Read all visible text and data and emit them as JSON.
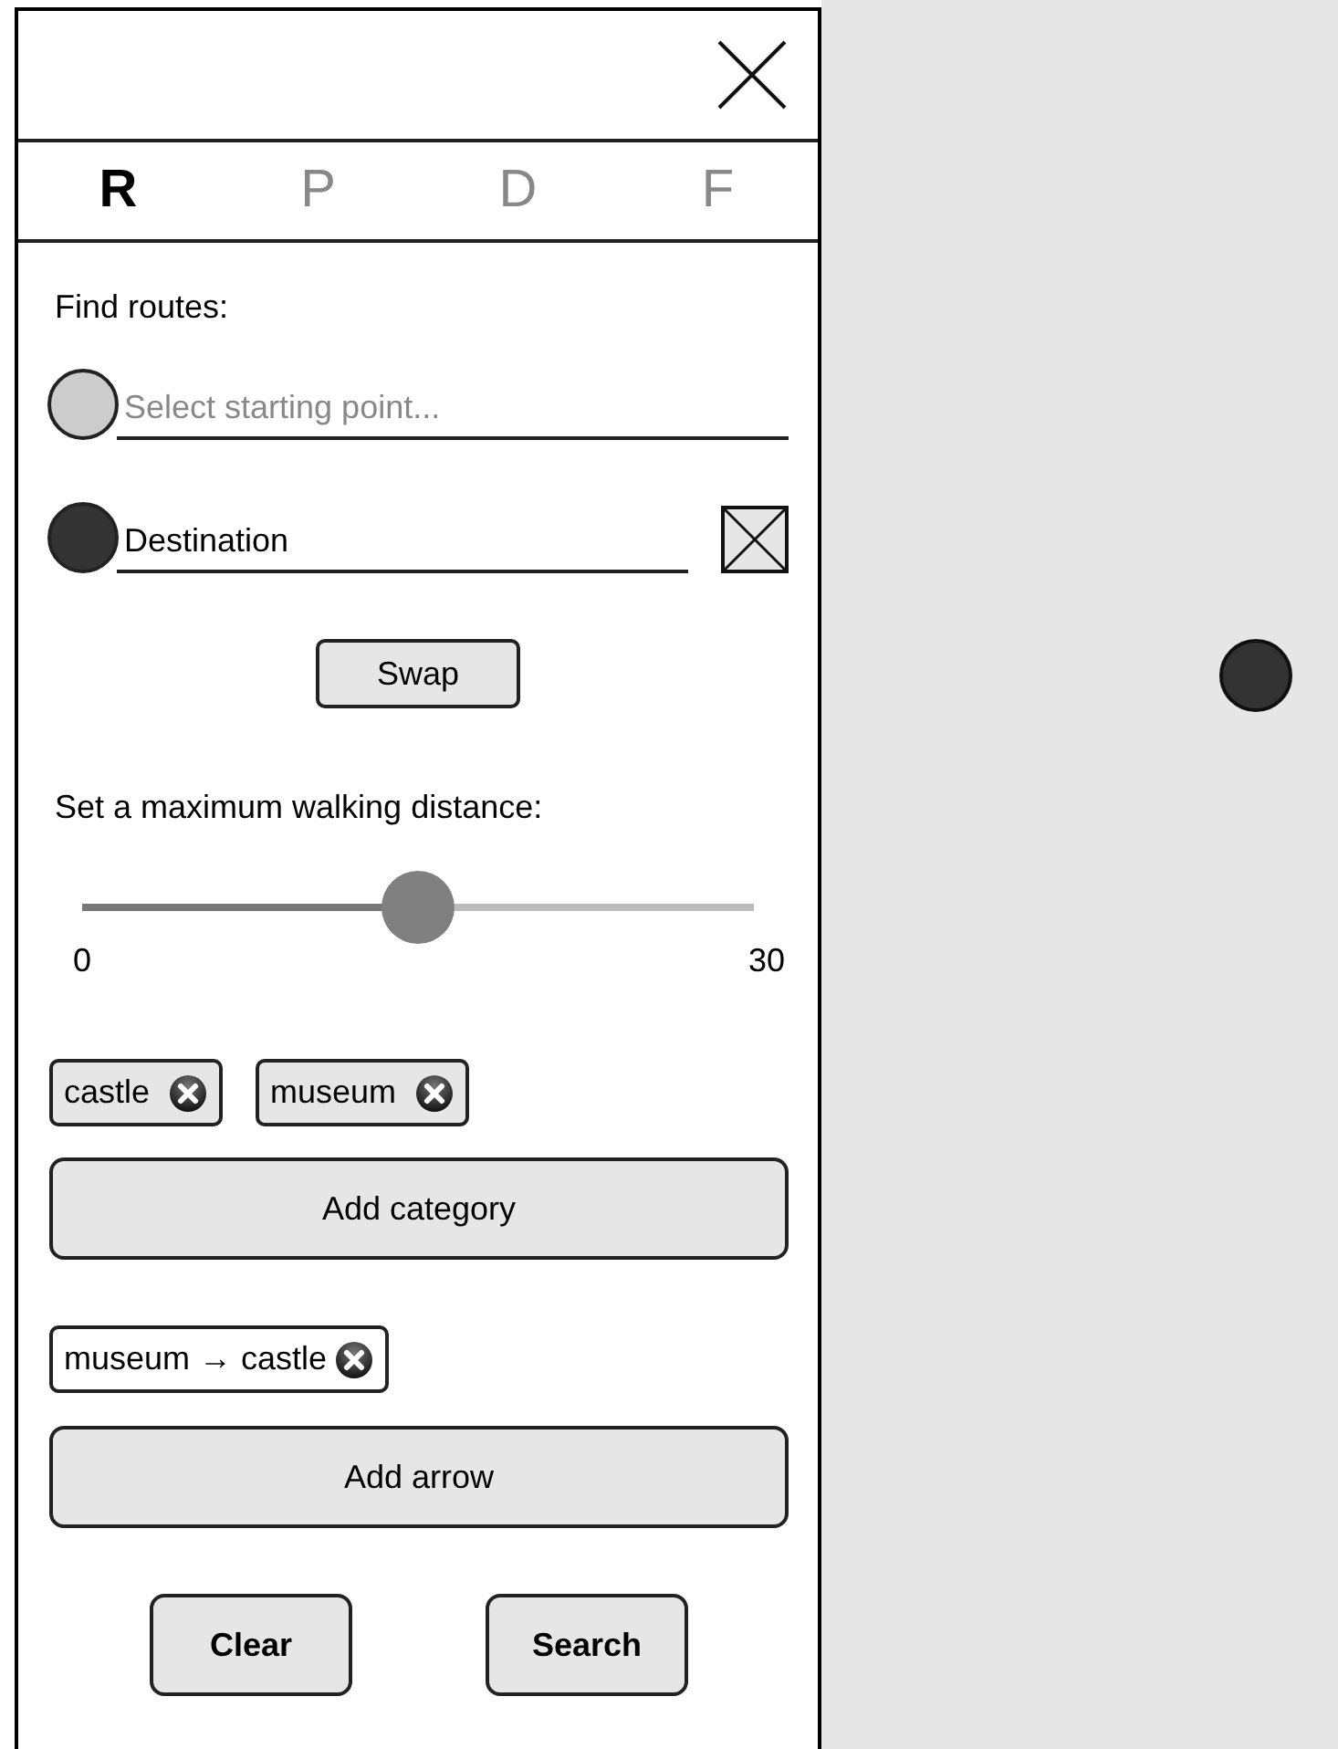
{
  "tabs": [
    {
      "label": "R",
      "selected": true
    },
    {
      "label": "P",
      "selected": false
    },
    {
      "label": "D",
      "selected": false
    },
    {
      "label": "F",
      "selected": false
    }
  ],
  "heading": "Find routes:",
  "points": [
    {
      "kind": "start",
      "placeholder": "Select starting point...",
      "color": "#cccccc"
    },
    {
      "kind": "destination",
      "value": "Destination",
      "color": "#333333"
    }
  ],
  "swap_button": "Swap",
  "distance": {
    "label": "Set a maximum walking distance:",
    "level": 0.5,
    "min": "0",
    "max": "30"
  },
  "categories": [
    {
      "label": "castle"
    },
    {
      "label": "museum"
    }
  ],
  "add_category_button": "Add category",
  "arrows": [
    {
      "label": "museum → castle"
    }
  ],
  "add_arrow_button": "Add arrow",
  "buttons": [
    "Clear",
    "Search"
  ]
}
